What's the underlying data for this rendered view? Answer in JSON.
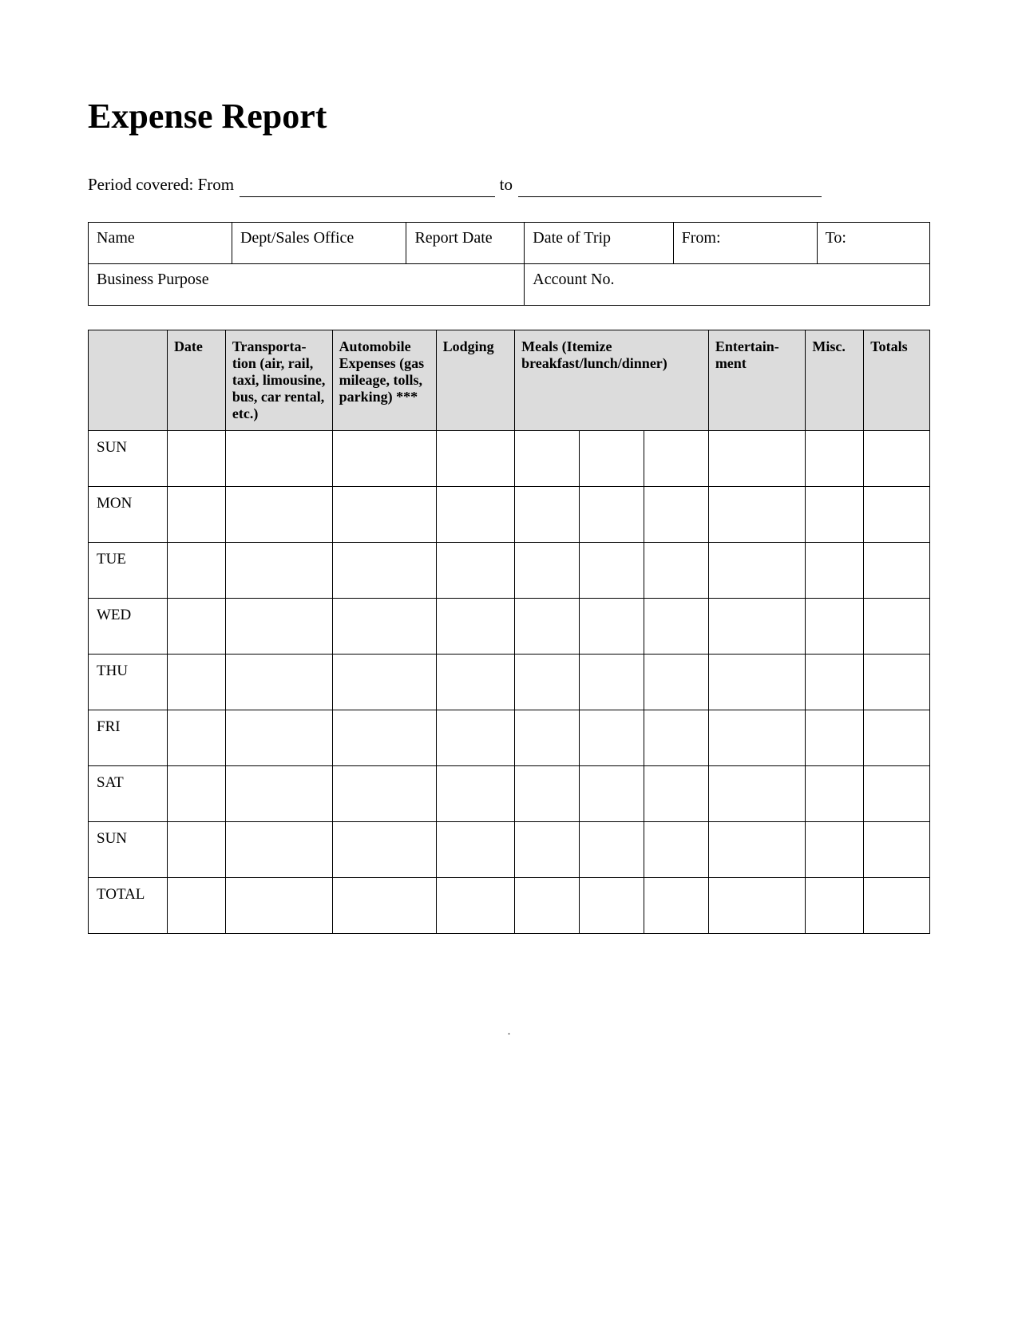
{
  "title": "Expense Report",
  "period": {
    "prefix": "Period covered: From",
    "joiner": "to"
  },
  "info": {
    "name": "Name",
    "dept": "Dept/Sales Office",
    "report_date": "Report Date",
    "date_of_trip": "Date of Trip",
    "from": "From:",
    "to": "To:",
    "business_purpose": "Business Purpose",
    "account_no": "Account No."
  },
  "headers": {
    "blank": "",
    "date": "Date",
    "transportation": "Transporta-\ntion (air, rail, taxi, limousine, bus, car rental, etc.)",
    "automobile": "Automobile Expenses (gas mileage, tolls, parking) ***",
    "lodging": "Lodging",
    "meals": "Meals (Itemize breakfast/lunch/dinner)",
    "entertainment": "Entertain-\nment",
    "misc": "Misc.",
    "totals": "Totals"
  },
  "days": [
    "SUN",
    "MON",
    "TUE",
    "WED",
    "THU",
    "FRI",
    "SAT",
    "SUN",
    "TOTAL"
  ],
  "footer_mark": "."
}
